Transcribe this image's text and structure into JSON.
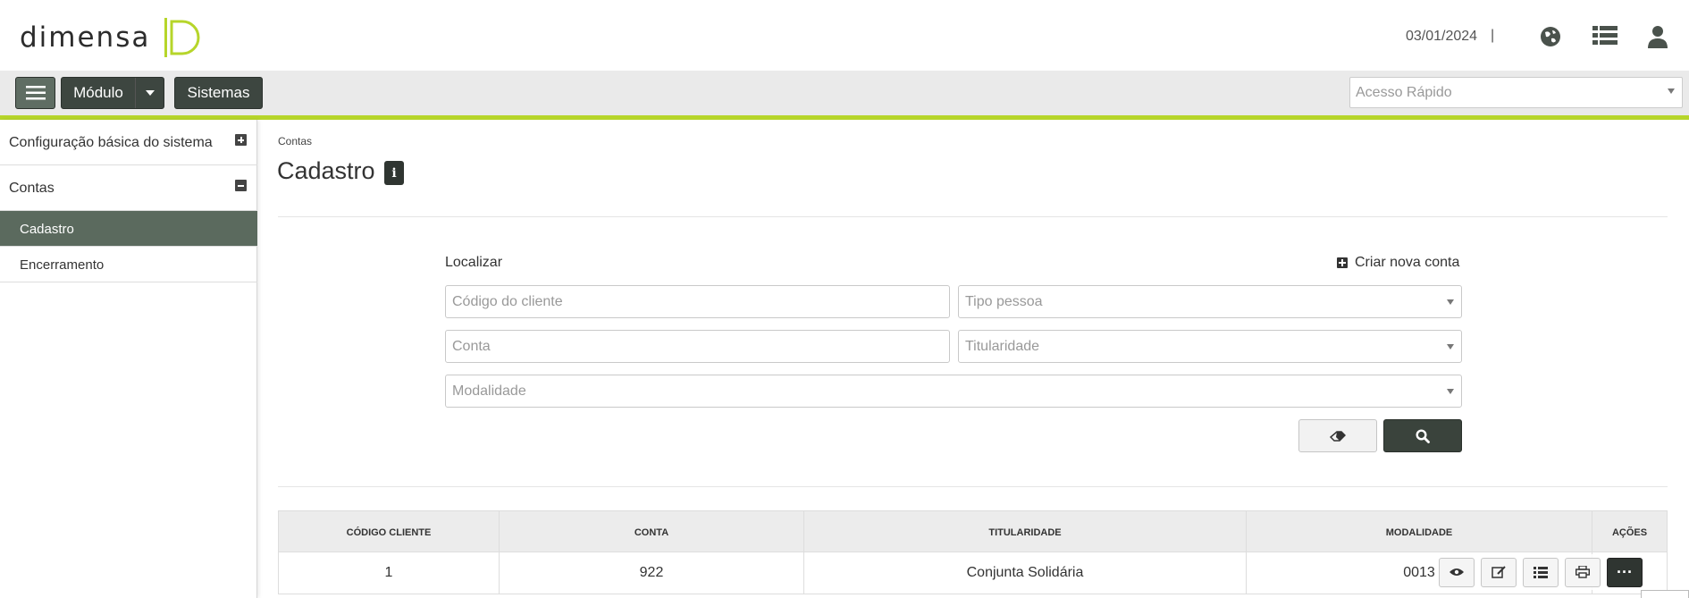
{
  "header": {
    "logo_text": "DIMENSA",
    "date": "03/01/2024",
    "date_separator": "|",
    "icons": [
      "globe-icon",
      "list-icon",
      "user-icon"
    ]
  },
  "toolbar": {
    "modulo_label": "Módulo",
    "sistemas_label": "Sistemas",
    "quick_access_placeholder": "Acesso Rápido"
  },
  "sidebar": {
    "groups": [
      {
        "label": "Configuração básica do sistema",
        "state": "collapsed"
      },
      {
        "label": "Contas",
        "state": "expanded"
      }
    ],
    "items": [
      {
        "label": "Cadastro",
        "active": true
      },
      {
        "label": "Encerramento",
        "active": false
      }
    ]
  },
  "main": {
    "breadcrumb": "Contas",
    "title": "Cadastro",
    "info_icon": "i",
    "search": {
      "label": "Localizar",
      "create_label": "Criar nova conta",
      "fields": {
        "codigo_cliente_placeholder": "Código do cliente",
        "tipo_pessoa_placeholder": "Tipo pessoa",
        "conta_placeholder": "Conta",
        "titularidade_placeholder": "Titularidade",
        "modalidade_placeholder": "Modalidade"
      }
    },
    "table": {
      "headers": [
        "CÓDIGO CLIENTE",
        "CONTA",
        "TITULARIDADE",
        "MODALIDADE",
        "AÇÕES"
      ],
      "rows": [
        {
          "codigo_cliente": "1",
          "conta": "922",
          "titularidade": "Conjunta Solidária",
          "modalidade": "0013"
        }
      ],
      "row_actions": [
        "eye-icon",
        "edit-icon",
        "list-icon",
        "print-icon",
        "more-icon"
      ],
      "more_label": "···"
    }
  },
  "colors": {
    "accent": "#b6d52a",
    "dark_button": "#3d4640",
    "sidebar_active": "#5b6a5e"
  }
}
